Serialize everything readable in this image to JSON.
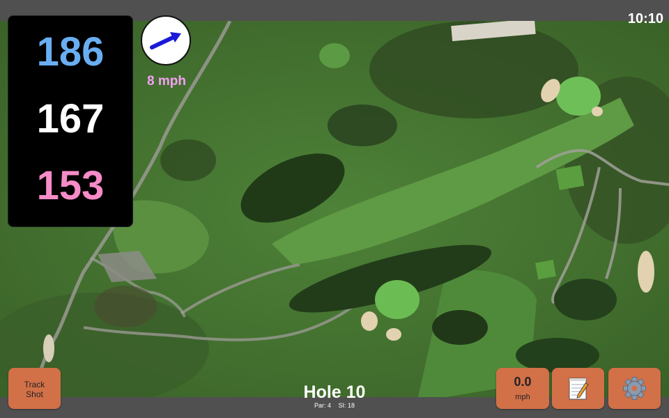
{
  "clock": {
    "time": "10:10"
  },
  "yardages": {
    "back": "186",
    "middle": "167",
    "front": "153"
  },
  "wind": {
    "speed": "8 mph",
    "arrow_icon": "arrow-right-icon"
  },
  "hole": {
    "title": "Hole 10",
    "par": "Par: 4",
    "stroke_index": "SI: 18"
  },
  "buttons": {
    "track_shot_line1": "Track",
    "track_shot_line2": "Shot",
    "speed_value": "0.0",
    "speed_unit": "mph",
    "notes_icon": "notepad-icon",
    "settings_icon": "gear-icon"
  },
  "colors": {
    "back_yardage": "#6aaef2",
    "middle_yardage": "#ffffff",
    "front_yardage": "#f78bc7",
    "wind_speed": "#f4a0f4",
    "button": "#d27048"
  }
}
